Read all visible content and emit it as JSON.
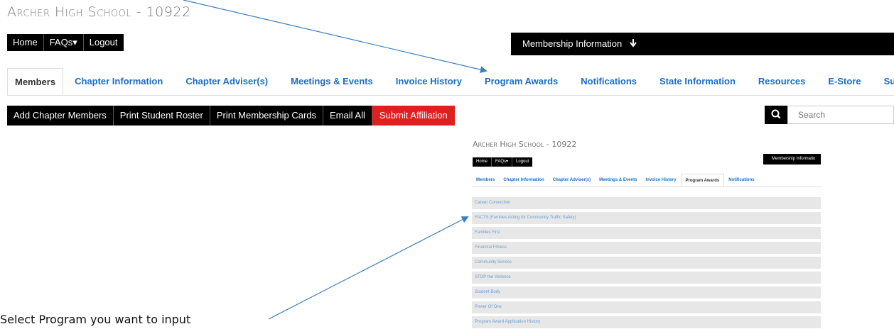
{
  "school_title": "Archer High School - 10922",
  "top_nav": [
    {
      "label": "Home"
    },
    {
      "label": "FAQs▾"
    },
    {
      "label": "Logout"
    }
  ],
  "membership_bar": {
    "label": "Membership Information",
    "icon": "arrow-down-icon"
  },
  "tabs": [
    {
      "label": "Members",
      "active": true
    },
    {
      "label": "Chapter Information"
    },
    {
      "label": "Chapter Adviser(s)"
    },
    {
      "label": "Meetings & Events"
    },
    {
      "label": "Invoice History"
    },
    {
      "label": "Program Awards"
    },
    {
      "label": "Notifications"
    },
    {
      "label": "State Information"
    },
    {
      "label": "Resources"
    },
    {
      "label": "E-Store"
    },
    {
      "label": "Surveys"
    }
  ],
  "actions": [
    {
      "label": "Add Chapter Members"
    },
    {
      "label": "Print Student Roster"
    },
    {
      "label": "Print Membership Cards"
    },
    {
      "label": "Email All"
    },
    {
      "label": "Submit Affiliation",
      "color": "#e02020"
    }
  ],
  "search": {
    "placeholder": "Search",
    "icon": "search-icon"
  },
  "inset": {
    "school_title": "Archer High School - 10922",
    "top_nav": [
      "Home",
      "FAQs▾",
      "Logout"
    ],
    "membership_label": "Membership Informatio",
    "tabs": [
      "Members",
      "Chapter Information",
      "Chapter Adviser(s)",
      "Meetings & Events",
      "Invoice History",
      "Program Awards",
      "Notifications"
    ],
    "active_tab": "Program Awards",
    "programs": [
      "Career Connection",
      "FACTS (Families Acting for Community Traffic Safety)",
      "Families First",
      "Financial Fitness",
      "Community Service",
      "STOP the Violence",
      "Student Body",
      "Power Of One",
      "Program Award Application History"
    ]
  },
  "instruction_text": "Select Program you want to input",
  "colors": {
    "link": "#1a6ec2",
    "accent_red": "#e02020",
    "bar_black": "#000000",
    "arrow": "#3a7fc1"
  }
}
